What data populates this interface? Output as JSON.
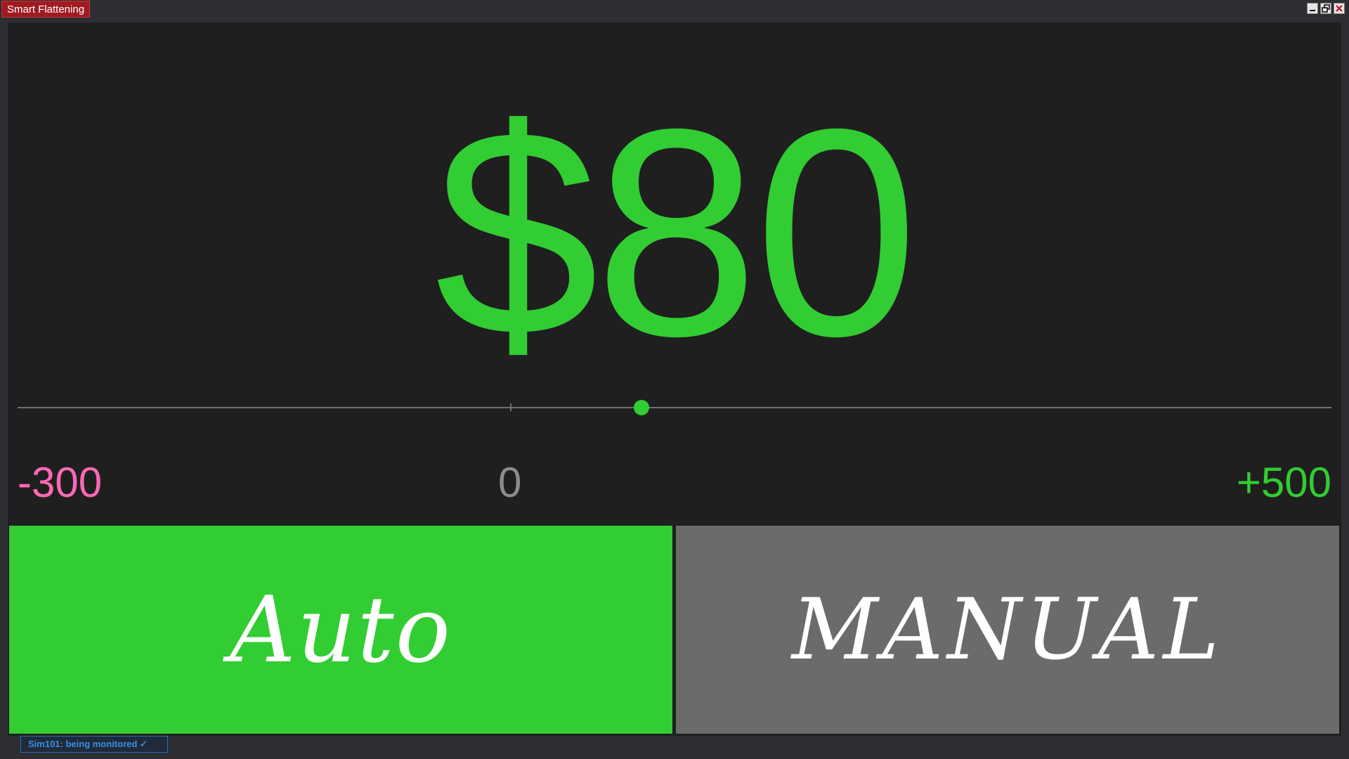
{
  "window": {
    "title": "Smart Flattening",
    "controls": {
      "minimize_icon": "minimize-icon",
      "restore_icon": "restore-icon",
      "close_icon": "close-icon"
    }
  },
  "pnl": {
    "display": "$80",
    "value": 80,
    "color": "#32cd32"
  },
  "slider": {
    "min": -300,
    "max": 500,
    "value": 80,
    "min_label": "-300",
    "zero_label": "0",
    "max_label": "+500",
    "min_color": "#ff69b4",
    "zero_color": "#8c8c8c",
    "max_color": "#32cd32"
  },
  "modes": {
    "auto_label": "Auto",
    "manual_label": "MANUAL",
    "auto_color": "#32cd32",
    "manual_color": "#6b6b6b",
    "active": "Auto"
  },
  "status": {
    "text": "Sim101:  being monitored ✓"
  }
}
